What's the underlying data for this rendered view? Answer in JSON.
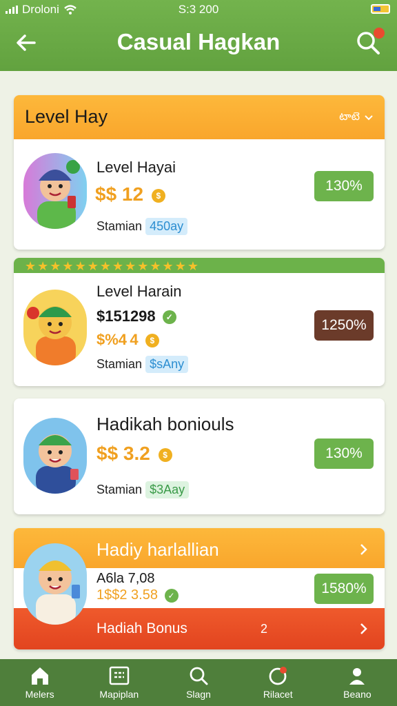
{
  "status": {
    "carrier": "Droloni",
    "time": "S:3 200"
  },
  "appbar": {
    "title": "Casual Hagkan"
  },
  "section": {
    "title": "Level Hay",
    "action": "ట  టెఆఆ"
  },
  "cards": [
    {
      "title": "Level Hayai",
      "price": "$$ 12",
      "price_full": "$$ 12",
      "coin_symbol": "$",
      "label": "Stamian",
      "chip": "450ay",
      "percent": "130%"
    },
    {
      "title": "Level Harain",
      "price_primary": "$151298",
      "price_secondary": "$%4 4",
      "label": "Stamian",
      "chip": "$sAny",
      "percent": "1250%"
    },
    {
      "title": "Hadikah boniouls",
      "price": "$$ 3.2",
      "label": "Stamian",
      "chip": "$3Aay",
      "percent": "130%"
    },
    {
      "header": "Hadiy harlallian",
      "line1": "A6la 7,08",
      "line2": "1$$2 3.58",
      "percent": "1580%",
      "bonus_label": "Hadiah Bonus",
      "bonus_count": "2"
    }
  ],
  "nav": [
    {
      "label": "Melers",
      "icon": "home-icon"
    },
    {
      "label": "Mapiplan",
      "icon": "grid-icon"
    },
    {
      "label": "Slagn",
      "icon": "search-icon"
    },
    {
      "label": "Rilacet",
      "icon": "badge-icon"
    },
    {
      "label": "Beano",
      "icon": "user-icon"
    }
  ],
  "colors": {
    "appbar": "#62a23f",
    "orange": "#fbb03b",
    "green_btn": "#6db34c",
    "brown_btn": "#6b3b2a",
    "bonus": "#e74b27",
    "nav": "#4f7f3b"
  }
}
